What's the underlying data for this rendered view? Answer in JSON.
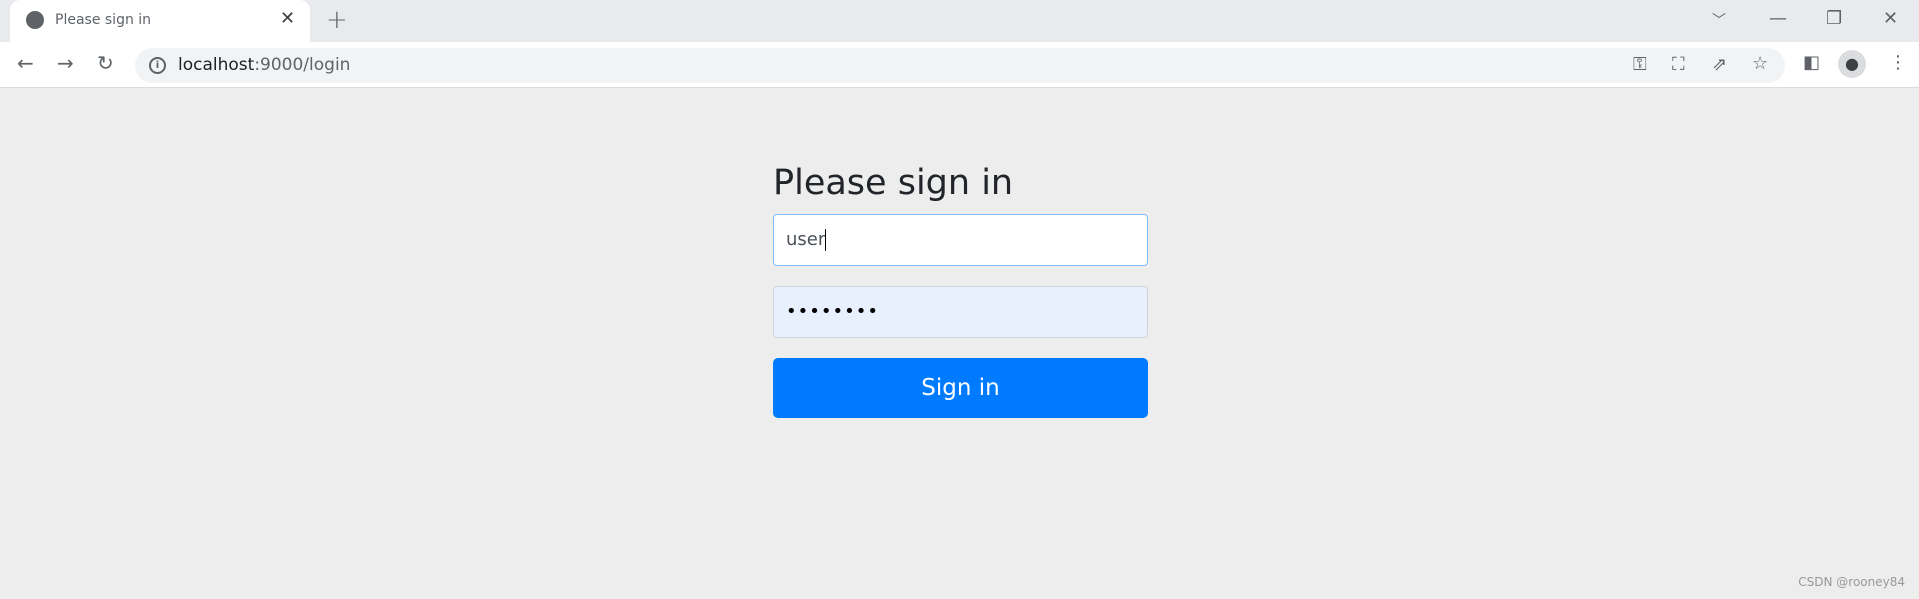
{
  "browser": {
    "tab_title": "Please sign in",
    "url_host": "localhost",
    "url_rest": ":9000/login"
  },
  "page": {
    "heading": "Please sign in",
    "username_value": "user",
    "password_mask": "••••••••",
    "submit_label": "Sign in"
  },
  "colors": {
    "button": "#007bff",
    "autofill": "#e8f0fe",
    "focus_border": "#80bdff"
  },
  "watermark": "CSDN @rooney84"
}
